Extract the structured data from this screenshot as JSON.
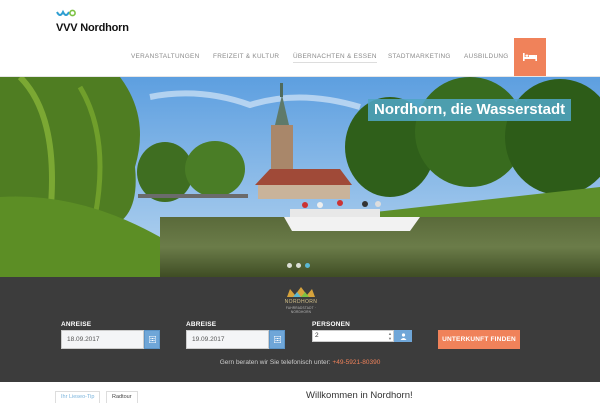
{
  "brand": {
    "name": "VVV Nordhorn",
    "accent": "#f0825a",
    "teal": "#5ab8d3"
  },
  "nav": {
    "items": [
      {
        "label": "VERANSTALTUNGEN"
      },
      {
        "label": "FREIZEIT & KULTUR"
      },
      {
        "label": "ÜBERNACHTEN & ESSEN"
      },
      {
        "label": "STADTMARKETING"
      },
      {
        "label": "AUSBILDUNG"
      }
    ],
    "bed_icon": "bed-icon"
  },
  "hero": {
    "title": "Nordhorn, die Wasserstadt",
    "slides": 3,
    "active_slide": 3
  },
  "booking": {
    "logo_name": "NORDHORN",
    "logo_sub": "FAHRRADSTADT · NORDHORN",
    "arrival_label": "ANREISE",
    "arrival_value": "18.09.2017",
    "departure_label": "ABREISE",
    "departure_value": "19.09.2017",
    "persons_label": "PERSONEN",
    "persons_value": "2",
    "find_button": "UNTERKUNFT FINDEN",
    "phone_text": "Gern beraten wir Sie telefonisch unter:",
    "phone_number": "+49-5921-80390"
  },
  "bottom": {
    "pill_1": "Ihr Lieseo-Tip",
    "pill_2": "Radtour",
    "welcome": "Willkommen in Nordhorn!"
  }
}
